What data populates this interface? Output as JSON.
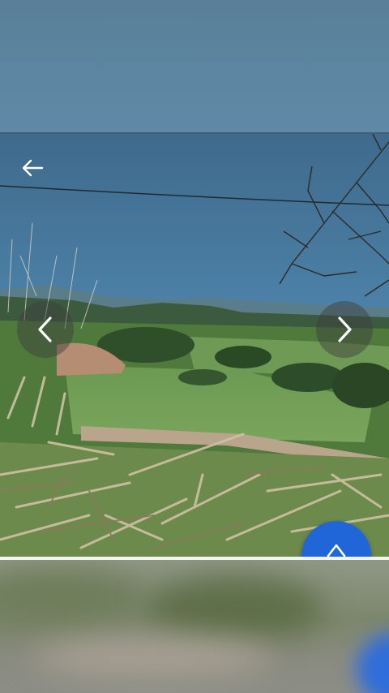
{
  "viewer": {
    "back_icon": "arrow-left-icon",
    "prev_icon": "chevron-left-icon",
    "next_icon": "chevron-right-icon",
    "fab_icon": "chevron-up-icon",
    "fab_color": "#2166d9"
  },
  "colors": {
    "sky": "#5c86a2",
    "divider": "#f4f4f4"
  }
}
